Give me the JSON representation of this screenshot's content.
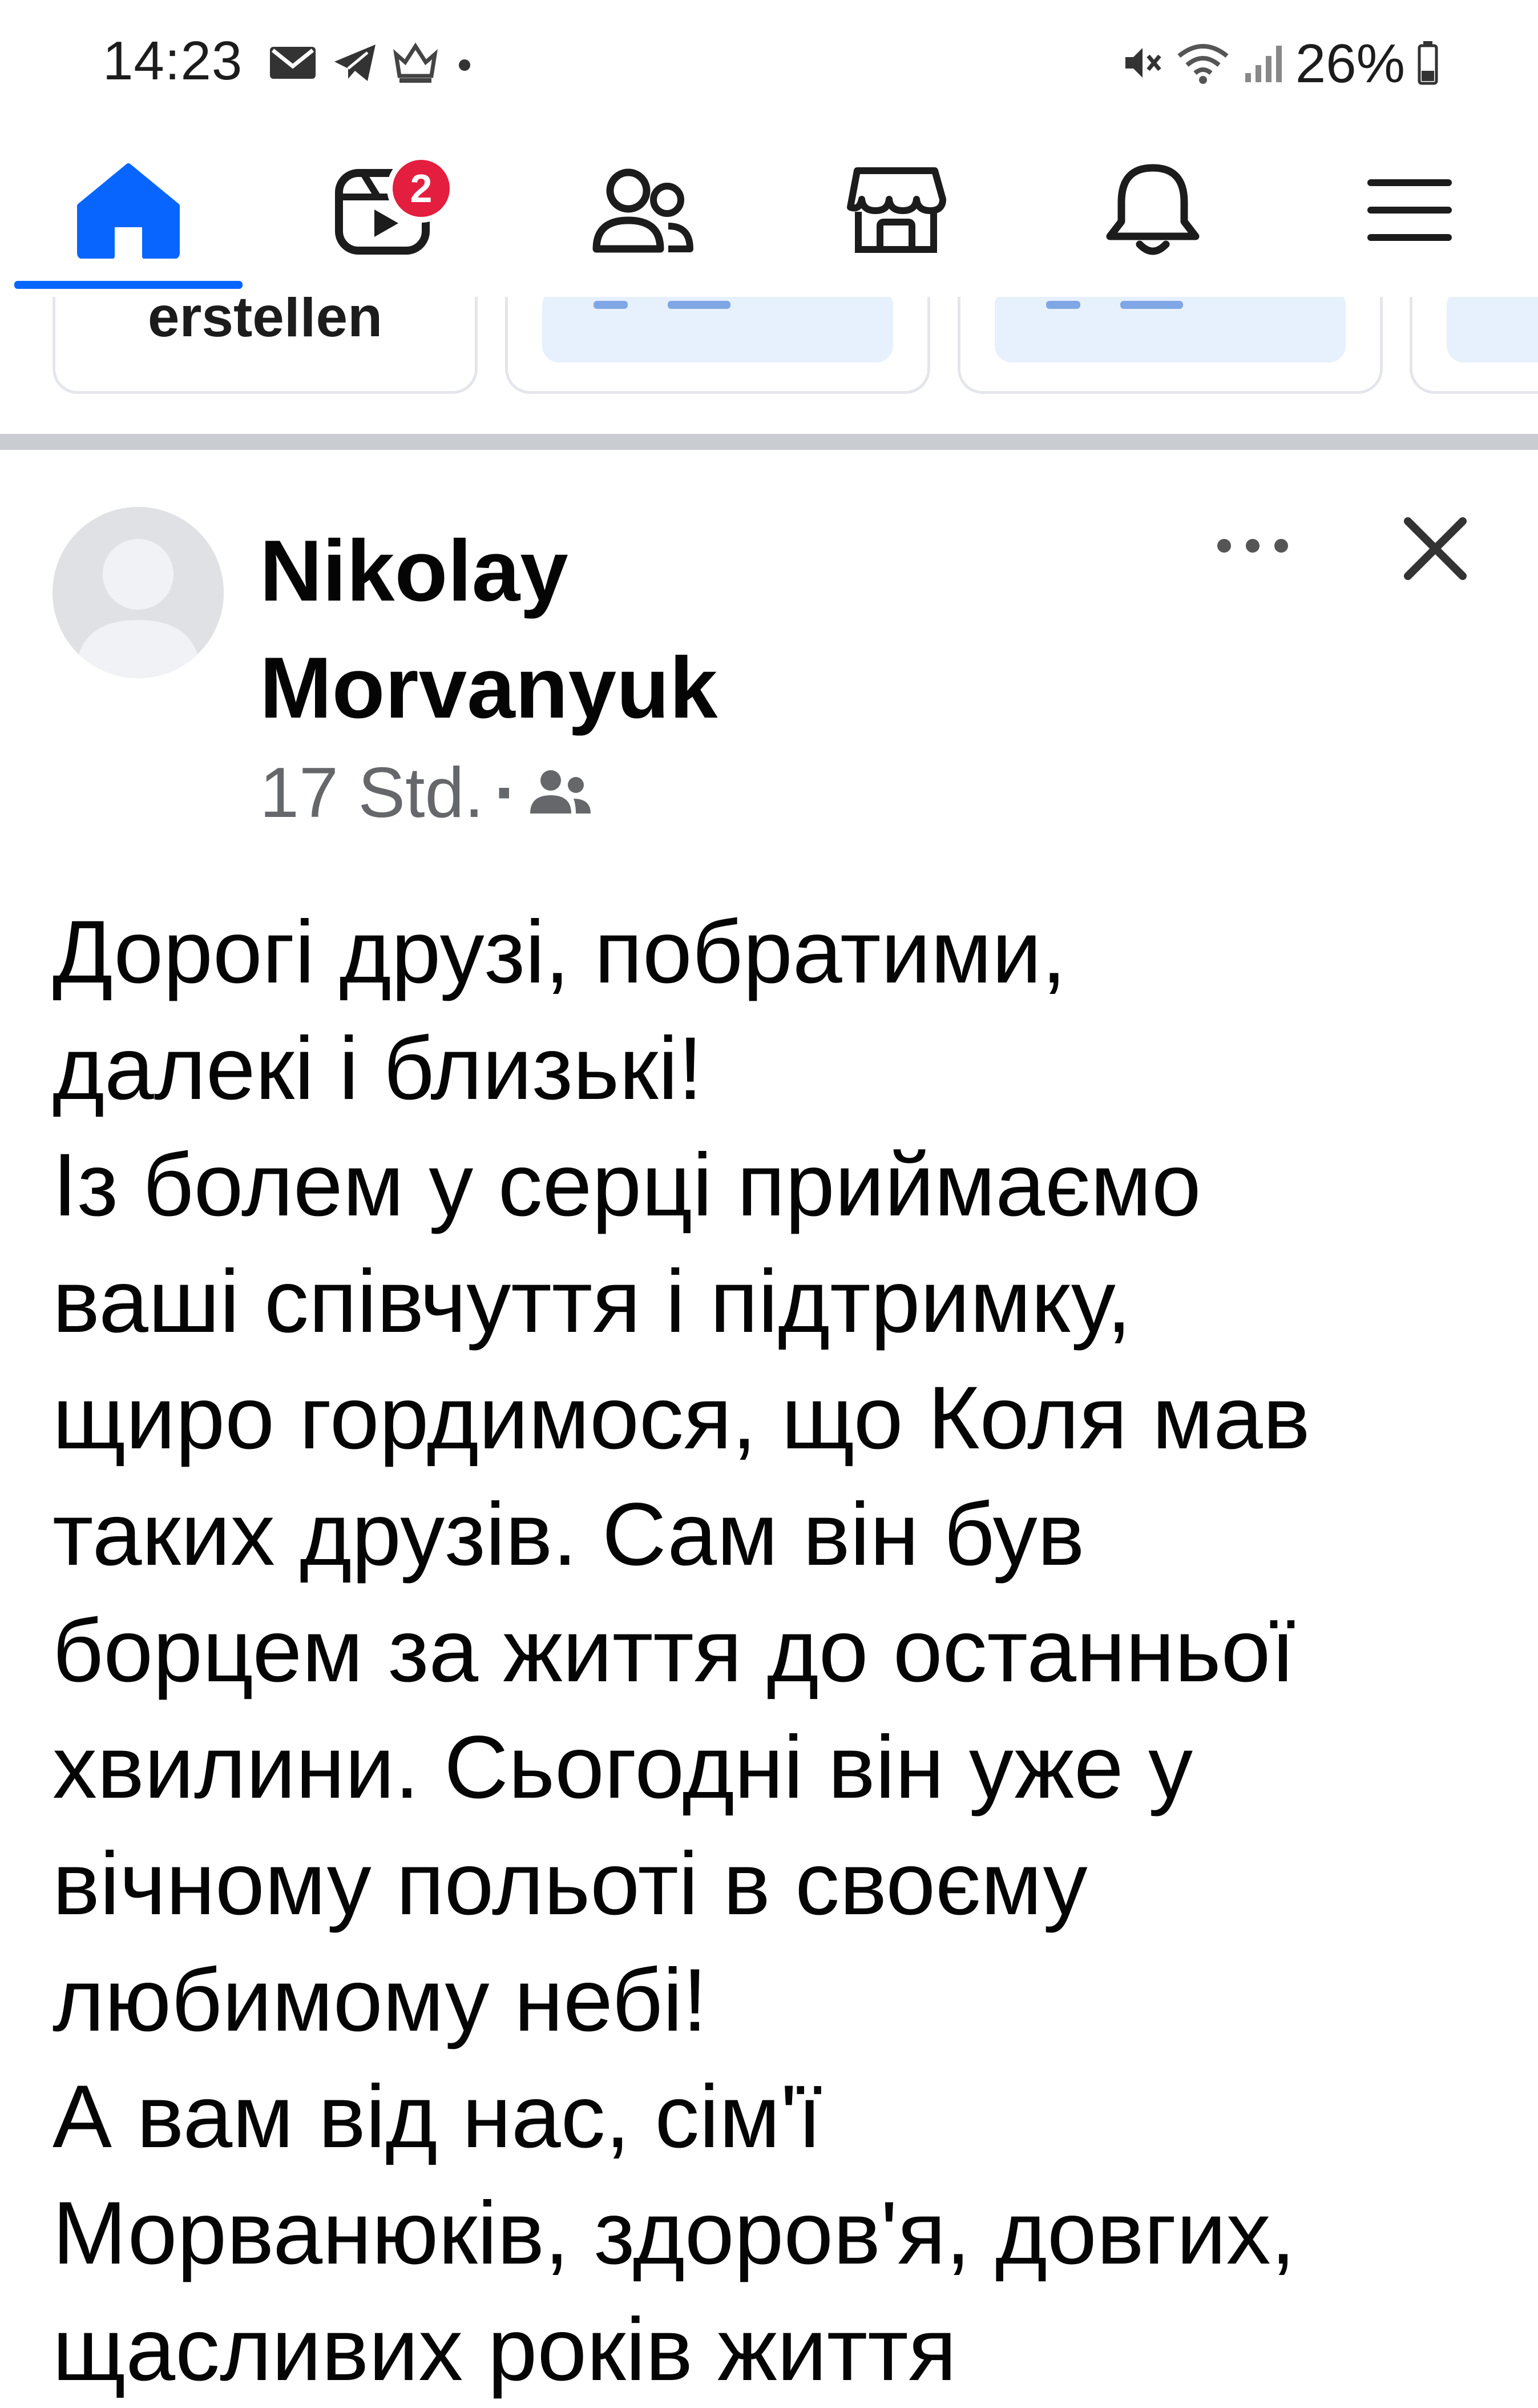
{
  "status_bar": {
    "time": "14:23",
    "battery": "26%",
    "left_icons": [
      "mail-icon",
      "telegram-icon",
      "app-notification-icon",
      "dot-icon"
    ],
    "right_icons": [
      "mute-icon",
      "wifi-icon",
      "signal-icon",
      "battery-icon"
    ]
  },
  "nav": {
    "items": [
      "home-icon",
      "video-icon",
      "friends-icon",
      "marketplace-icon",
      "notifications-icon",
      "menu-icon"
    ],
    "video_badge": "2",
    "active": "home",
    "accent_color": "#0866ff",
    "badge_color": "#e41e3f"
  },
  "stories": {
    "create_label": "erstellen"
  },
  "post": {
    "author_line1": "Nikolay",
    "author_line2": "Morvanyuk",
    "time": "17 Std.",
    "separator": "·",
    "audience_icon": "friends-audience-icon",
    "lines": [
      "Дорогі друзі, побратими,",
      "далекі і близькі!",
      "Із болем у серці приймаємо",
      "ваші співчуття і підтримку,",
      "щиро гордимося, що Коля мав",
      "таких друзів. Сам він був",
      "борцем за життя до останньої",
      "хвилини. Сьогодні він уже у",
      "вічному польоті в своєму",
      "любимому небі!",
      "А вам від нас, сім'ї",
      "Морванюків, здоров'я, довгих,",
      "щасливих років життя"
    ]
  }
}
